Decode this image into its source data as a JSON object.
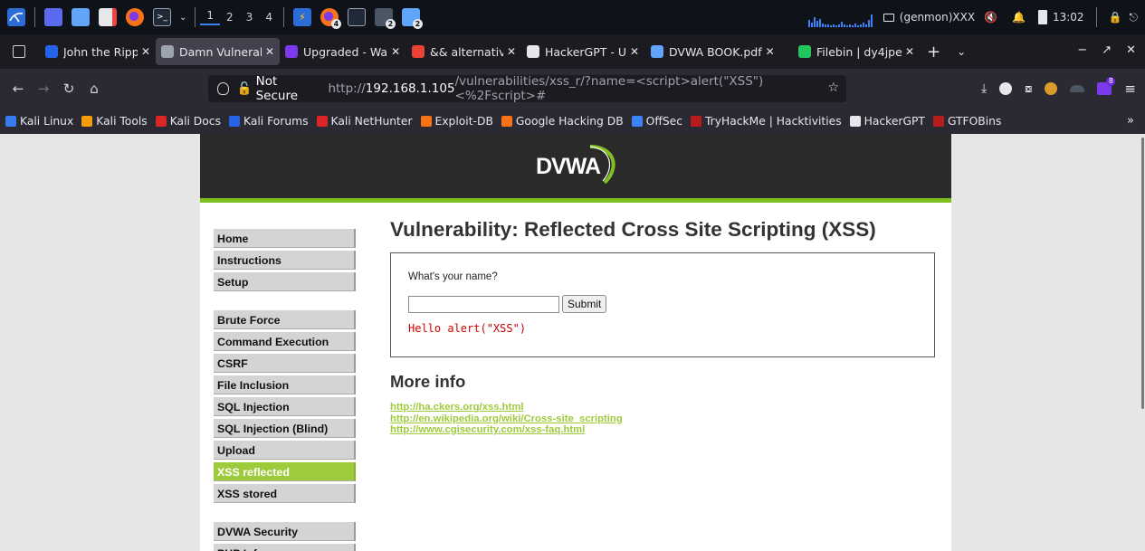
{
  "panel": {
    "workspaces": [
      "1",
      "2",
      "3",
      "4"
    ],
    "active_workspace": "1",
    "badges": {
      "firefox": "4",
      "terminal": "2",
      "files": "2"
    },
    "genmon": "(genmon)XXX",
    "clock": "13:02"
  },
  "tabs": [
    {
      "title": "John the Ripper",
      "color": "#2563eb"
    },
    {
      "title": "Damn Vulnerable",
      "color": "#9ca3af"
    },
    {
      "title": "Upgraded - Wa",
      "color": "#7c3aed"
    },
    {
      "title": "&& alternative",
      "color": "#ea4335"
    },
    {
      "title": "HackerGPT - U",
      "color": "#e5e7eb"
    },
    {
      "title": "DVWA BOOK.pdf",
      "color": "#60a5fa"
    },
    {
      "title": "Filebin | dy4jpe",
      "color": "#22c55e"
    }
  ],
  "active_tab_index": 1,
  "urlbar": {
    "security": "Not Secure",
    "scheme": "http://",
    "host": "192.168.1.105",
    "path": "/vulnerabilities/xss_r/?name=<script>alert(\"XSS\")<%2Fscript>#"
  },
  "toolbar": {
    "extension_badge": "8"
  },
  "bookmarks": [
    {
      "label": "Kali Linux",
      "color": "#367bf0"
    },
    {
      "label": "Kali Tools",
      "color": "#f59e0b"
    },
    {
      "label": "Kali Docs",
      "color": "#dc2626"
    },
    {
      "label": "Kali Forums",
      "color": "#2563eb"
    },
    {
      "label": "Kali NetHunter",
      "color": "#dc2626"
    },
    {
      "label": "Exploit-DB",
      "color": "#f97316"
    },
    {
      "label": "Google Hacking DB",
      "color": "#f97316"
    },
    {
      "label": "OffSec",
      "color": "#3b82f6"
    },
    {
      "label": "TryHackMe | Hacktivities",
      "color": "#b91c1c"
    },
    {
      "label": "HackerGPT",
      "color": "#e5e7eb"
    },
    {
      "label": "GTFOBins",
      "color": "#b91c1c"
    }
  ],
  "dvwa": {
    "logo_text": "DVWA",
    "menu_groups": [
      [
        "Home",
        "Instructions",
        "Setup"
      ],
      [
        "Brute Force",
        "Command Execution",
        "CSRF",
        "File Inclusion",
        "SQL Injection",
        "SQL Injection (Blind)",
        "Upload",
        "XSS reflected",
        "XSS stored"
      ],
      [
        "DVWA Security",
        "PHP Info"
      ]
    ],
    "selected_menu": "XSS reflected",
    "title": "Vulnerability: Reflected Cross Site Scripting (XSS)",
    "question": "What's your name?",
    "input_value": "",
    "submit_label": "Submit",
    "output": "Hello alert(\"XSS\")",
    "more_info_heading": "More info",
    "links": [
      "http://ha.ckers.org/xss.html",
      "http://en.wikipedia.org/wiki/Cross-site_scripting",
      "http://www.cgisecurity.com/xss-faq.html"
    ]
  }
}
